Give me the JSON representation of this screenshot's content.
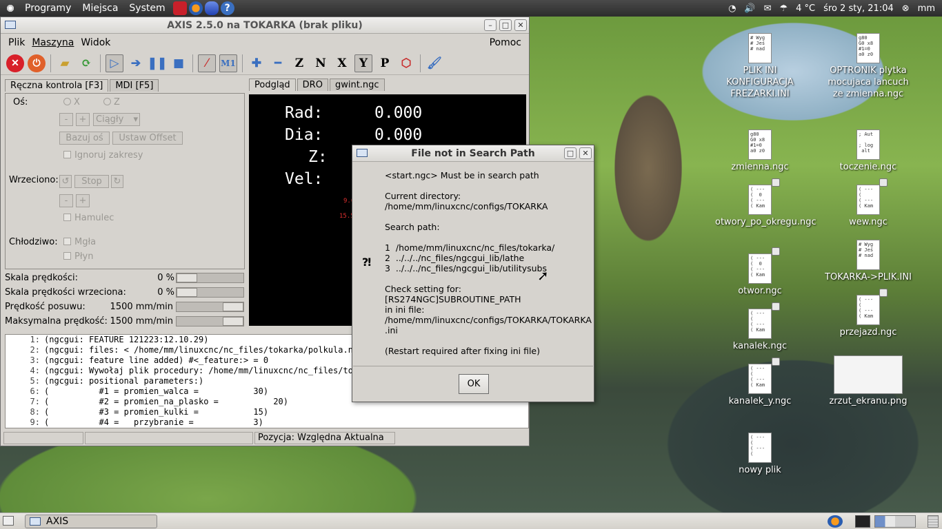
{
  "topbar": {
    "menus": [
      "Programy",
      "Miejsca",
      "System"
    ],
    "temperature": "4 °C",
    "datetime": "śro  2 sty, 21:04",
    "user": "mm"
  },
  "desktop_icons": [
    {
      "label": "PLIK INI KONFIGURACJA FREZARKI.INI",
      "preview": "# Wyg\n# Jeś\n# nad"
    },
    {
      "label": "OPTRONIK plytka mocujaca lancuch ze zmienna.ngc",
      "preview": "g80\nG0 x8\n#1=0\na0 z0"
    },
    {
      "label": "zmienna.ngc",
      "preview": "g80\nG0 x8\n#1=0\na0 z0"
    },
    {
      "label": "toczenie.ngc",
      "preview": "; Aut\n\n; log\n alt"
    },
    {
      "label": "otwory_po_okregu.ngc",
      "preview": "( ---\n(  0\n( ---\n( Kam"
    },
    {
      "label": "wew.ngc",
      "preview": "( ---\n(\n( ---\n( Kam"
    },
    {
      "label": "otwor.ngc",
      "preview": "( ---\n(  0\n( ---\n( Kam"
    },
    {
      "label": "TOKARKA->PLIK.INI",
      "preview": "# Wyg\n# Jeś\n# nad"
    },
    {
      "label": "kanalek.ngc",
      "preview": "( ---\n(\n( ---\n( Kam"
    },
    {
      "label": "przejazd.ngc",
      "preview": "( ---\n(\n( ---\n( Kam"
    },
    {
      "label": "kanalek_y.ngc",
      "preview": "( ---\n(\n( ---\n( Kam"
    },
    {
      "label": "zrzut_ekranu.png",
      "preview": ""
    },
    {
      "label": "nowy plik",
      "preview": "( ---\n(\n( ---\n("
    }
  ],
  "axis": {
    "title": "AXIS 2.5.0 na TOKARKA (brak pliku)",
    "menu": [
      "Plik",
      "Maszyna",
      "Widok"
    ],
    "help": "Pomoc",
    "left_tabs": [
      "Ręczna kontrola [F3]",
      "MDI [F5]"
    ],
    "right_tabs": [
      "Podgląd",
      "DRO",
      "gwint.ngc"
    ],
    "manual": {
      "axis_label": "Oś:",
      "axis_x": "X",
      "axis_z": "Z",
      "minus": "-",
      "plus": "+",
      "jog_mode": "Ciągły",
      "home": "Bazuj oś",
      "offset": "Ustaw Offset",
      "ignore_limits": "Ignoruj zakresy",
      "spindle_label": "Wrzeciono:",
      "stop": "Stop",
      "brake": "Hamulec",
      "coolant_label": "Chłodziwo:",
      "mist": "Mgła",
      "flood": "Płyn"
    },
    "overrides": [
      {
        "label": "Skala prędkości:",
        "value": "0 %",
        "level": 0.0
      },
      {
        "label": "Skala prędkości wrzeciona:",
        "value": "0 %",
        "level": 0.0
      },
      {
        "label": "Prędkość posuwu:",
        "value": "1500 mm/min",
        "level": 1.0
      },
      {
        "label": "Maksymalna prędkość:",
        "value": "1500 mm/min",
        "level": 1.0
      }
    ],
    "dro": [
      {
        "name": "Rad:",
        "value": "0.000"
      },
      {
        "name": "Dia:",
        "value": "0.000"
      },
      {
        "name": "Z:",
        "value": ""
      },
      {
        "name": "Vel:",
        "value": ""
      }
    ],
    "dro_small": [
      "9.0",
      "15.5"
    ],
    "gcode_lines": [
      {
        "n": "1:",
        "text": "(ngcgui: FEATURE 121223:12.10.29)"
      },
      {
        "n": "2:",
        "text": "(ngcgui: files: < /home/mm/linuxcnc/nc_files/tokarka/polkula.ngc"
      },
      {
        "n": "3:",
        "text": "(ngcgui: feature line added) #<_feature:> = 0"
      },
      {
        "n": "4:",
        "text": "(ngcgui: Wywołaj plik procedury: /home/mm/linuxcnc/nc_files/toka"
      },
      {
        "n": "5:",
        "text": "(ngcgui: positional parameters:)"
      },
      {
        "n": "6:",
        "text": "(          #1 = promien_walca =           30)"
      },
      {
        "n": "7:",
        "text": "(          #2 = promien_na_plasko =           20)"
      },
      {
        "n": "8:",
        "text": "(          #3 = promien_kulki =           15)"
      },
      {
        "n": "9:",
        "text": "(          #4 =   przybranie =            3)"
      }
    ],
    "status": [
      "",
      "",
      "Pozycja: Względna Aktualna"
    ]
  },
  "dialog": {
    "title": "File not in Search Path",
    "message": "<start.ngc> Must be in search path\n\nCurrent directory:\n/home/mm/linuxcnc/configs/TOKARKA\n\nSearch path:\n\n1  /home/mm/linuxcnc/nc_files/tokarka/\n2  ../../../nc_files/ngcgui_lib/lathe\n3  ../../../nc_files/ngcgui_lib/utilitysubs\n\nCheck setting for:\n[RS274NGC]SUBROUTINE_PATH\nin ini file:\n/home/mm/linuxcnc/configs/TOKARKA/TOKARKA\n.ini\n\n(Restart required after fixing ini file)",
    "ok": "OK"
  },
  "taskbar": {
    "task": "AXIS"
  }
}
